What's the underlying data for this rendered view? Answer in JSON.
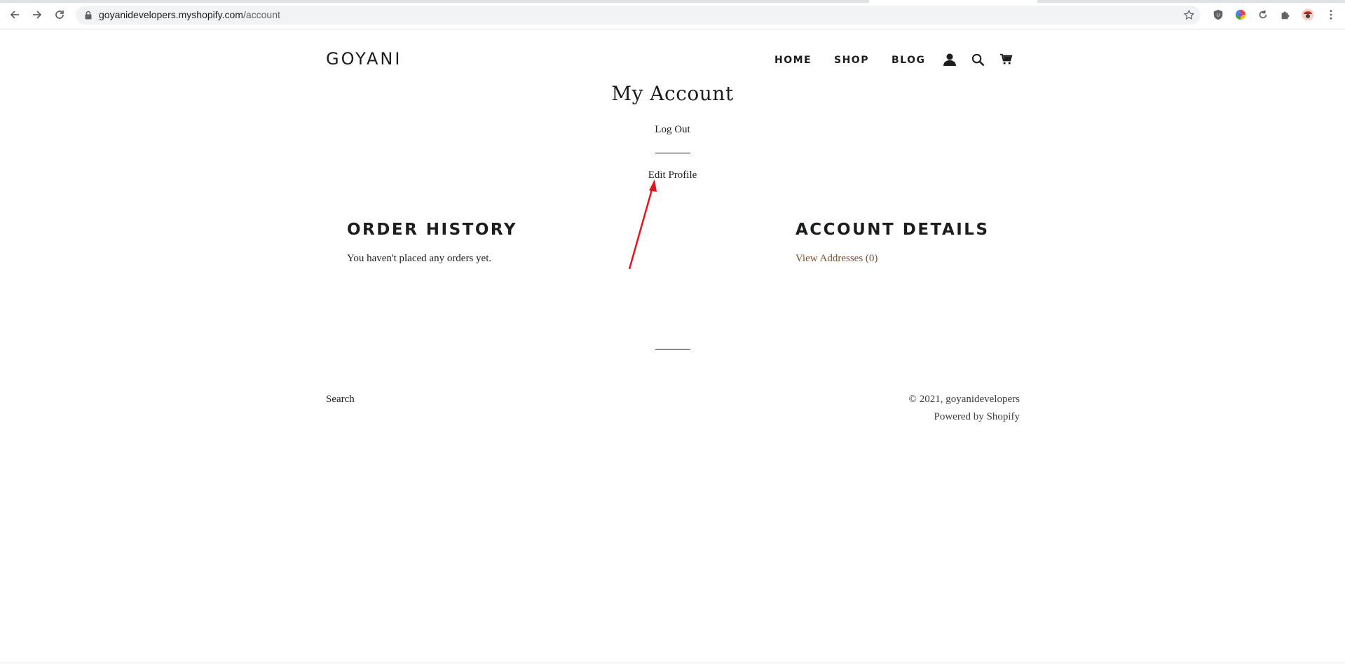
{
  "browser": {
    "url_host": "goyanidevelopers.myshopify.com",
    "url_path": "/account",
    "icons": {
      "back": "arrow-left-icon",
      "forward": "arrow-right-icon",
      "reload": "reload-icon",
      "lock": "lock-icon",
      "bookmark": "star-icon",
      "extensions": [
        "shield-extension-icon",
        "color-wheel-extension-icon",
        "refresh-extension-icon",
        "puzzle-icon",
        "profile-avatar-icon"
      ]
    }
  },
  "header": {
    "logo": "GOYANI",
    "nav": [
      "HOME",
      "SHOP",
      "BLOG"
    ],
    "icons": [
      "account-icon",
      "search-icon",
      "cart-icon"
    ]
  },
  "main": {
    "title": "My Account",
    "logout": "Log Out",
    "edit_profile": "Edit Profile",
    "order_history": {
      "heading": "ORDER HISTORY",
      "text": "You haven't placed any orders yet."
    },
    "account_details": {
      "heading": "ACCOUNT DETAILS",
      "link": "View Addresses (0)"
    }
  },
  "footer": {
    "search": "Search",
    "copyright": "© 2021, goyanidevelopers",
    "powered": "Powered by Shopify"
  },
  "colors": {
    "text": "#1c1d1d",
    "link_accent": "#7f4f36",
    "annotation_arrow": "#e8141c"
  }
}
